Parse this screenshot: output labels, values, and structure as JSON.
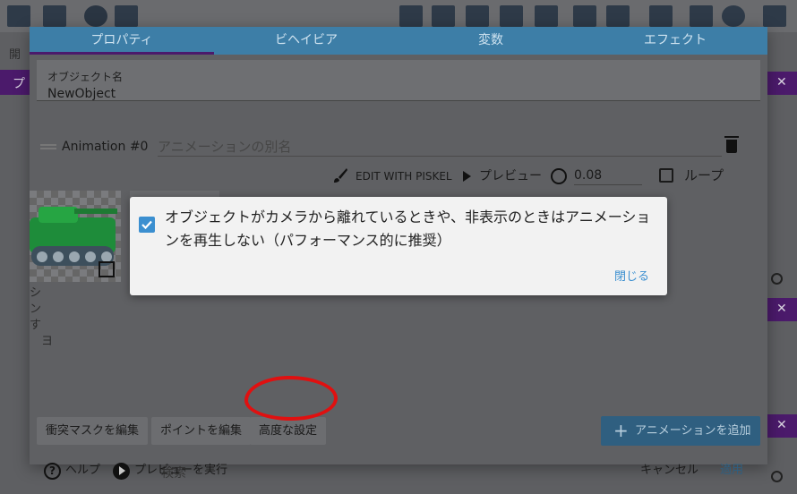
{
  "dialog": {
    "tabs": [
      {
        "label": "プロパティ",
        "active": true
      },
      {
        "label": "ビヘイビア",
        "active": false
      },
      {
        "label": "変数",
        "active": false
      },
      {
        "label": "エフェクト",
        "active": false
      }
    ]
  },
  "object_name": {
    "label": "オブジェクト名",
    "value": "NewObject"
  },
  "animation": {
    "title": "Animation #0",
    "name_placeholder": "アニメーションの別名",
    "edit_with_piskel": "EDIT WITH PISKEL",
    "preview": "プレビュー",
    "timer_value": "0.08",
    "loop_label": "ループ"
  },
  "buttons": {
    "collision_mask": "衝突マスクを編集",
    "points": "ポイントを編集",
    "advanced": "高度な設定",
    "add_animation": "アニメーションを追加"
  },
  "footer": {
    "help": "ヘルプ",
    "run_preview": "プレビューを実行",
    "cancel": "キャンセル",
    "apply": "適用"
  },
  "popup": {
    "checked": true,
    "text": "オブジェクトがカメラから離れているときや、非表示のときはアニメーションを再生しない（パフォーマンス的に推奨）",
    "close": "閉じる"
  },
  "background": {
    "search_placeholder": "検索",
    "panel_label": "開",
    "side_text": "シ\nン\nす\n　ヨ",
    "purple_label": "プ"
  },
  "colors": {
    "tab_bar": "#3d7ea7",
    "accent_purple": "#4b1a6b",
    "popup_checkbox": "#3b8fd0",
    "annotation_red": "#e01010"
  }
}
